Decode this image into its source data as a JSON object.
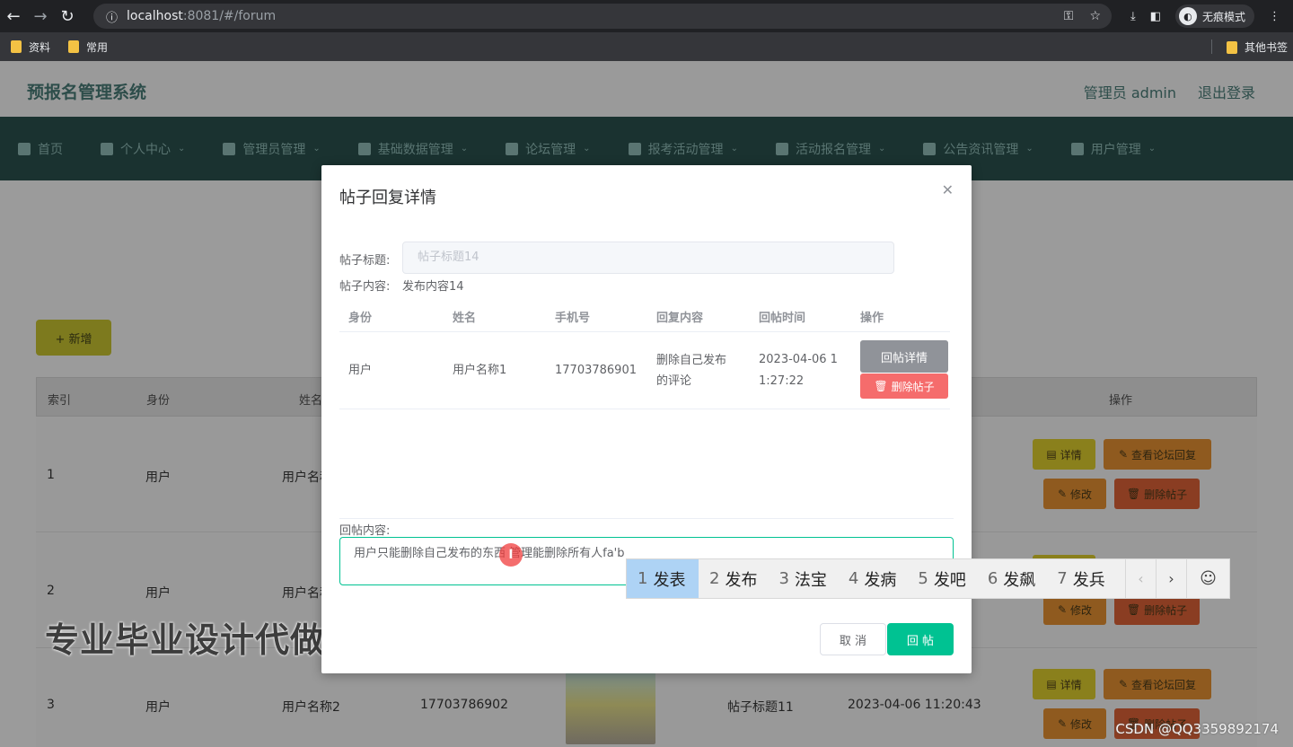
{
  "browser": {
    "url_host": "localhost",
    "url_path": ":8081/#/forum",
    "incognito_label": "无痕模式",
    "bookmarks": [
      "资料",
      "常用"
    ],
    "other_bookmarks": "其他书签"
  },
  "app": {
    "title": "预报名管理系统",
    "user": "管理员 admin",
    "logout": "退出登录",
    "nav": [
      "首页",
      "个人中心",
      "管理员管理",
      "基础数据管理",
      "论坛管理",
      "报考活动管理",
      "活动报名管理",
      "公告资讯管理",
      "用户管理"
    ],
    "add_button": "+ 新增",
    "table_headers": [
      "索引",
      "身份",
      "姓名",
      "操作"
    ],
    "rows": [
      {
        "index": "1",
        "identity": "用户",
        "name": "用户名称1"
      },
      {
        "index": "2",
        "identity": "用户",
        "name": "用户名称1"
      },
      {
        "index": "3",
        "identity": "用户",
        "name": "用户名称2",
        "phone": "17703786902",
        "title": "帖子标题11",
        "time": "2023-04-06 11:20:43"
      }
    ],
    "action_labels": {
      "detail": "详情",
      "view_replies": "查看论坛回复",
      "edit": "修改",
      "delete": "删除帖子"
    }
  },
  "modal": {
    "title": "帖子回复详情",
    "title_label": "帖子标题:",
    "title_placeholder": "帖子标题14",
    "content_label": "帖子内容:",
    "content_value": "发布内容14",
    "reply_table_headers": [
      "身份",
      "姓名",
      "手机号",
      "回复内容",
      "回帖时间",
      "操作"
    ],
    "reply_row": {
      "identity": "用户",
      "name": "用户名称1",
      "phone": "17703786901",
      "content_line1": "删除自己发布",
      "content_line2": "的评论",
      "time_line1": "2023-04-06 1",
      "time_line2": "1:27:22",
      "detail_button": "回帖详情",
      "delete_button": "删除帖子"
    },
    "reply_label": "回帖内容:",
    "reply_text": "用户只能删除自己发布的东西 管理能删除所有人fa'b",
    "cancel": "取 消",
    "submit": "回 帖"
  },
  "ime": {
    "candidates": [
      {
        "num": "1",
        "text": "发表"
      },
      {
        "num": "2",
        "text": "发布"
      },
      {
        "num": "3",
        "text": "法宝"
      },
      {
        "num": "4",
        "text": "发病"
      },
      {
        "num": "5",
        "text": "发吧"
      },
      {
        "num": "6",
        "text": "发飙"
      },
      {
        "num": "7",
        "text": "发兵"
      }
    ]
  },
  "watermark": "专业毕业设计代做",
  "csdn": "CSDN @QQ3359892174"
}
